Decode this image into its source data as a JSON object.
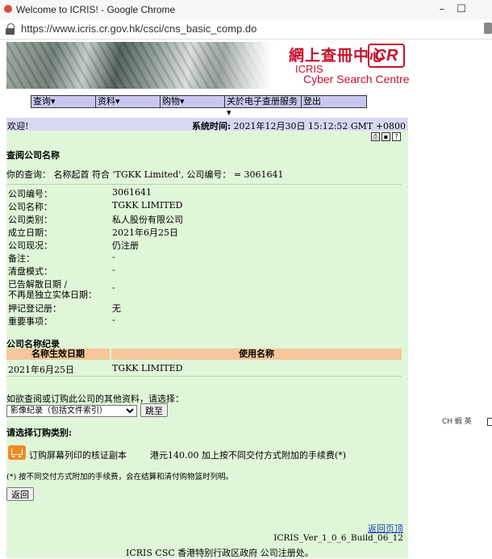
{
  "window": {
    "title": "Welcome to ICRIS! - Google Chrome",
    "minimize": "–",
    "maximize": "☐"
  },
  "url": "https://www.icris.cr.gov.hk/csci/cns_basic_comp.do",
  "banner": {
    "cn_title": "網上查冊中心",
    "logo_text": "CR",
    "icris": "ICRIS",
    "en_title": "Cyber Search Centre"
  },
  "menu": [
    {
      "label": "查询▾"
    },
    {
      "label": "资料▾"
    },
    {
      "label": "购物▾"
    },
    {
      "label": "关於电子查册服务▾"
    },
    {
      "label": "登出"
    }
  ],
  "welcome": "欢迎!",
  "system_time": {
    "label": "系统时间:",
    "value": "2021年12月30日 15:12:52 GMT +0800"
  },
  "page_title": "查阅公司名称",
  "query": "你的查询： 名称起首 符合 'TGKK Limited', 公司编号： = 3061641",
  "details": [
    {
      "label": "公司编号：",
      "value": "3061641"
    },
    {
      "label": "公司名称：",
      "value": "TGKK LIMITED"
    },
    {
      "label": "公司类别：",
      "value": "私人股份有限公司"
    },
    {
      "label": "成立日期：",
      "value": "2021年6月25日"
    },
    {
      "label": "公司现况：",
      "value": "仍注册"
    },
    {
      "label": "备注：",
      "value": "-"
    },
    {
      "label": "清盘模式：",
      "value": "-"
    },
    {
      "label": "已告解散日期 /",
      "label2": "不再是独立实体日期：",
      "value": "-"
    },
    {
      "label": "押记登记册：",
      "value": "无"
    },
    {
      "label": "重要事项：",
      "value": "-"
    }
  ],
  "name_history": {
    "title": "公司名称纪录",
    "col_date": "名称生效日期",
    "col_name": "使用名称",
    "rows": [
      {
        "date": "2021年6月25日",
        "name": "TGKK LIMITED"
      }
    ]
  },
  "other_info": {
    "prompt": "如欲查阅或订购此公司的其他资料，请选择：",
    "selected": "影像纪录（包括文件索引）",
    "go": "跳至"
  },
  "order": {
    "title": "请选择订购类别:",
    "item": "订购屏幕列印的核证副本",
    "price": "港元140.00 加上按不同交付方式附加的手续费(*)",
    "note": "(*) 按不同交付方式附加的手续费，会在结算和清付购物篮时列明。"
  },
  "back_button": "返回",
  "back_to_top": "返回页顶",
  "version": "ICRIS_Ver_1_0_6_Build_06_12",
  "footer": "ICRIS CSC 香港特别行政区政府 公司注册处。",
  "ime": "CH 蝦 英"
}
